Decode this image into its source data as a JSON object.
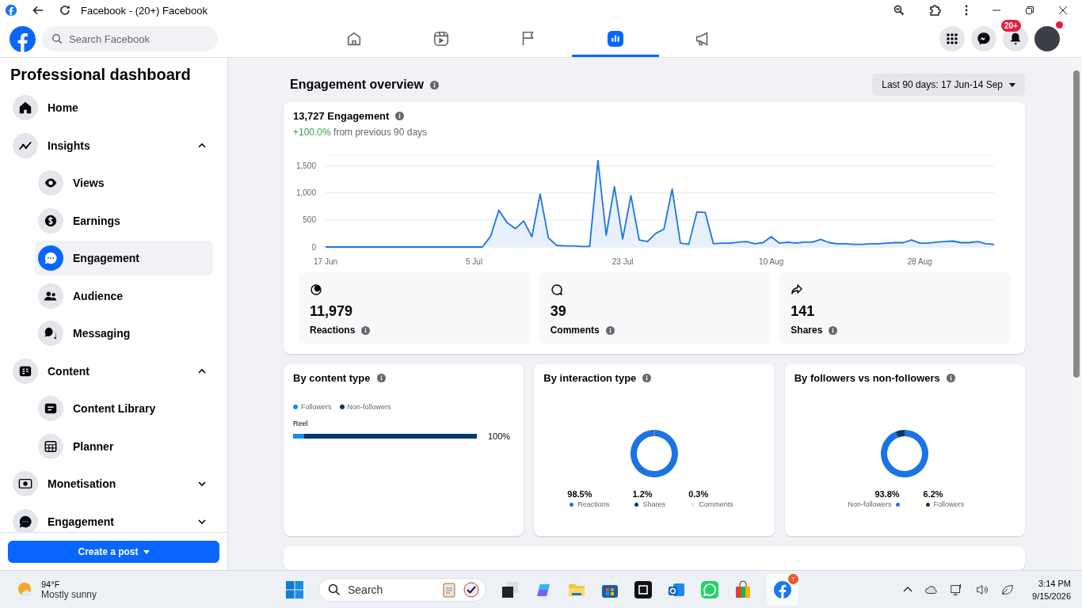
{
  "browser": {
    "title": "Facebook - (20+) Facebook"
  },
  "header": {
    "search": {
      "placeholder": "Search Facebook"
    },
    "nav_tabs": [
      {
        "kind": "home",
        "selected": false
      },
      {
        "kind": "video",
        "selected": false
      },
      {
        "kind": "flag",
        "selected": false
      },
      {
        "kind": "chart",
        "selected": true
      },
      {
        "kind": "megaphone",
        "selected": false
      }
    ],
    "notifications_badge": "20+"
  },
  "sidebar": {
    "title": "Professional dashboard",
    "items": [
      {
        "label": "Home",
        "selected": false
      },
      {
        "label": "Insights",
        "expanded": true,
        "selected": false,
        "children": [
          {
            "label": "Views",
            "selected": false
          },
          {
            "label": "Earnings",
            "selected": false
          },
          {
            "label": "Engagement",
            "selected": true
          },
          {
            "label": "Audience",
            "selected": false
          },
          {
            "label": "Messaging",
            "selected": false
          }
        ]
      },
      {
        "label": "Content",
        "expanded": true,
        "selected": false,
        "children": [
          {
            "label": "Content Library",
            "selected": false
          },
          {
            "label": "Planner",
            "selected": false
          }
        ]
      },
      {
        "label": "Monetisation",
        "expanded": false,
        "selected": false
      },
      {
        "label": "Engagement",
        "expanded": false,
        "selected": false
      }
    ],
    "create_button": "Create a post"
  },
  "main": {
    "title": "Engagement overview",
    "date_range": "Last 90 days: 17 Jun-14 Sep",
    "overview": {
      "total": "13,727 Engagement",
      "change": "+100.0%",
      "change_text": "from previous 90 days",
      "chart_data": {
        "type": "area",
        "categories": [
          "17 Jun",
          null,
          null,
          null,
          null,
          null,
          null,
          null,
          null,
          null,
          null,
          null,
          null,
          null,
          null,
          null,
          null,
          null,
          "5 Jul",
          null,
          null,
          null,
          null,
          null,
          null,
          null,
          null,
          null,
          null,
          null,
          null,
          null,
          null,
          null,
          null,
          null,
          "23 Jul",
          null,
          null,
          null,
          null,
          null,
          null,
          null,
          null,
          null,
          null,
          null,
          null,
          null,
          null,
          null,
          null,
          null,
          "10 Aug",
          null,
          null,
          null,
          null,
          null,
          null,
          null,
          null,
          null,
          null,
          null,
          null,
          null,
          null,
          null,
          null,
          null,
          "28 Aug",
          null,
          null,
          null,
          null,
          null,
          null,
          null,
          null,
          null
        ],
        "series": [
          {
            "color": "#1b74e4",
            "values": [
              0,
              0,
              0,
              0,
              0,
              0,
              0,
              0,
              0,
              0,
              0,
              0,
              0,
              0,
              0,
              0,
              0,
              0,
              0,
              0,
              200,
              680,
              450,
              340,
              480,
              190,
              980,
              170,
              30,
              20,
              20,
              10,
              10,
              1600,
              220,
              1120,
              150,
              950,
              130,
              100,
              250,
              330,
              1070,
              70,
              50,
              650,
              640,
              60,
              70,
              70,
              90,
              100,
              60,
              80,
              190,
              70,
              90,
              70,
              90,
              90,
              140,
              80,
              60,
              60,
              50,
              50,
              60,
              60,
              70,
              80,
              80,
              130,
              70,
              70,
              90,
              100,
              110,
              80,
              80,
              100,
              60,
              50
            ]
          }
        ],
        "yticks": [
          {
            "value": 0,
            "label": "0"
          },
          {
            "value": 500,
            "label": "500"
          },
          {
            "value": 1000,
            "label": "1,000"
          },
          {
            "value": 1500,
            "label": "1,500"
          }
        ],
        "ylim": [
          0,
          1700
        ],
        "grid": true
      },
      "stats": [
        {
          "kind": "reactions",
          "value": "11,979",
          "label": "Reactions"
        },
        {
          "kind": "comments",
          "value": "39",
          "label": "Comments"
        },
        {
          "kind": "shares",
          "value": "141",
          "label": "Shares"
        }
      ]
    },
    "content_type": {
      "title": "By content type",
      "legend": [
        {
          "label": "Followers",
          "color": "#1b8bf0"
        },
        {
          "label": "Non-followers",
          "color": "#063970"
        }
      ],
      "rows": [
        {
          "label": "Reel",
          "level": 0.06,
          "value": "100%"
        }
      ]
    },
    "interaction_type": {
      "title": "By interaction type",
      "chart_data": {
        "type": "donut",
        "categories": [
          "Reactions",
          "Shares",
          "Comments"
        ],
        "series": [
          {
            "values": [
              98.5,
              1.2,
              0.3
            ]
          }
        ],
        "value_labels": [
          "98.5%",
          "1.2%",
          "0.3%"
        ]
      }
    },
    "followers": {
      "title": "By followers vs non-followers",
      "chart_data": {
        "type": "donut",
        "categories": [
          "Non-followers",
          "Followers"
        ],
        "series": [
          {
            "values": [
              93.8,
              6.2
            ]
          }
        ],
        "value_labels": [
          "93.8%",
          "6.2%"
        ]
      }
    }
  },
  "taskbar": {
    "temperature": "94°F",
    "weather": "Mostly sunny",
    "search": {
      "placeholder": "Search"
    },
    "time": "3:14 PM",
    "date": "9/15/2026",
    "facebook_badge": "T"
  }
}
